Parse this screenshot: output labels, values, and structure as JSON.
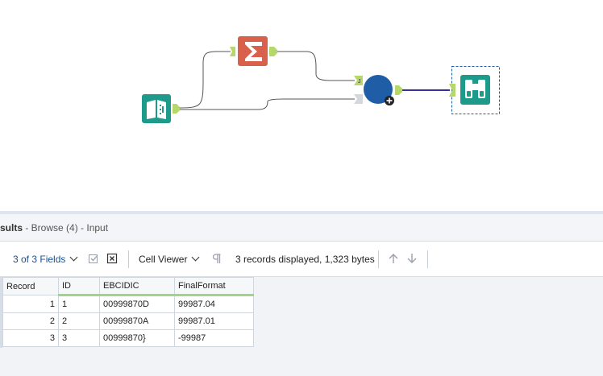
{
  "results": {
    "title_bold": "sults",
    "title_rest": " - Browse (4) - Input"
  },
  "toolbar": {
    "fields_label": "3 of 3 Fields",
    "cell_viewer_label": "Cell Viewer",
    "status_text": "3 records displayed, 1,323 bytes"
  },
  "table": {
    "columns": [
      "Record",
      "ID",
      "EBCIDIC",
      "FinalFormat"
    ],
    "rows": [
      [
        "1",
        "1",
        "00999870D",
        "99987.04"
      ],
      [
        "2",
        "2",
        "00999870A",
        "99987.01"
      ],
      [
        "3",
        "3",
        "00999870}",
        "-99987"
      ]
    ]
  },
  "workflow": {
    "tools": [
      "input-data-tool",
      "summarize-tool",
      "join-tool",
      "browse-tool"
    ],
    "colors": {
      "input": "#1e9a8a",
      "summarize": "#d9604a",
      "join": "#1f5ea6",
      "browse": "#1e9a8a",
      "anchor": "#b6d76a",
      "connection_active": "#3a2f9a"
    },
    "join_anchor_label": "J"
  }
}
